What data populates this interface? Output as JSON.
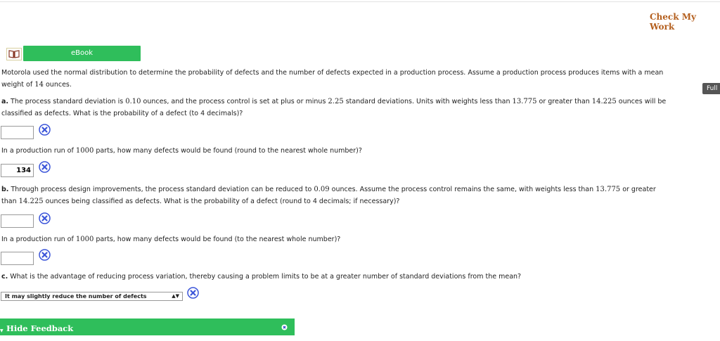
{
  "header": {
    "check_my_work": "Check My Work"
  },
  "ebook": {
    "label": "eBook",
    "icon": "book-icon"
  },
  "full_button": {
    "label": "Full"
  },
  "intro": {
    "line1": "Motorola used the normal distribution to determine the probability of defects and the number of defects expected in a production process. Assume a production process produces items with a mean",
    "line2_pre": "weight of ",
    "line2_num": "14",
    "line2_post": " ounces."
  },
  "part_a": {
    "letter": "a.",
    "t1": " The process standard deviation is ",
    "n1": "0.10",
    "t2": " ounces, and the process control is set at plus or minus ",
    "n2": "2.25",
    "t3": " standard deviations. Units with weights less than ",
    "n3": "13.775",
    "t4": " or greater than ",
    "n4": "14.225",
    "t5": " ounces will be",
    "line2": "classified as defects. What is the probability of a defect (to 4 decimals)?",
    "answer1": "",
    "q2_pre": "In a production run of ",
    "q2_num": "1000",
    "q2_post": " parts, how many defects would be found (round to the nearest whole number)?",
    "answer2": "134"
  },
  "part_b": {
    "letter": "b.",
    "t1": " Through process design improvements, the process standard deviation can be reduced to ",
    "n1": "0.09",
    "t2": " ounces. Assume the process control remains the same, with weights less than ",
    "n2": "13.775",
    "t3": " or greater",
    "l2_pre": "than ",
    "l2_num": "14.225",
    "l2_post": " ounces being classified as defects. What is the probability of a defect (round to 4 decimals; if necessary)?",
    "answer1": "",
    "q2_pre": "In a production run of ",
    "q2_num": "1000",
    "q2_post": " parts, how many defects would be found (to the nearest whole number)?",
    "answer2": ""
  },
  "part_c": {
    "letter": "c.",
    "text": " What is the advantage of reducing process variation, thereby causing a problem limits to be at a greater number of standard deviations from the mean?",
    "selected": "It may slightly reduce the number of defects"
  },
  "feedback": {
    "label": "Hide Feedback"
  },
  "colors": {
    "accent_green": "#2fbe5b",
    "incorrect_blue": "#3b55d9",
    "link_brown": "#b45f1e"
  }
}
